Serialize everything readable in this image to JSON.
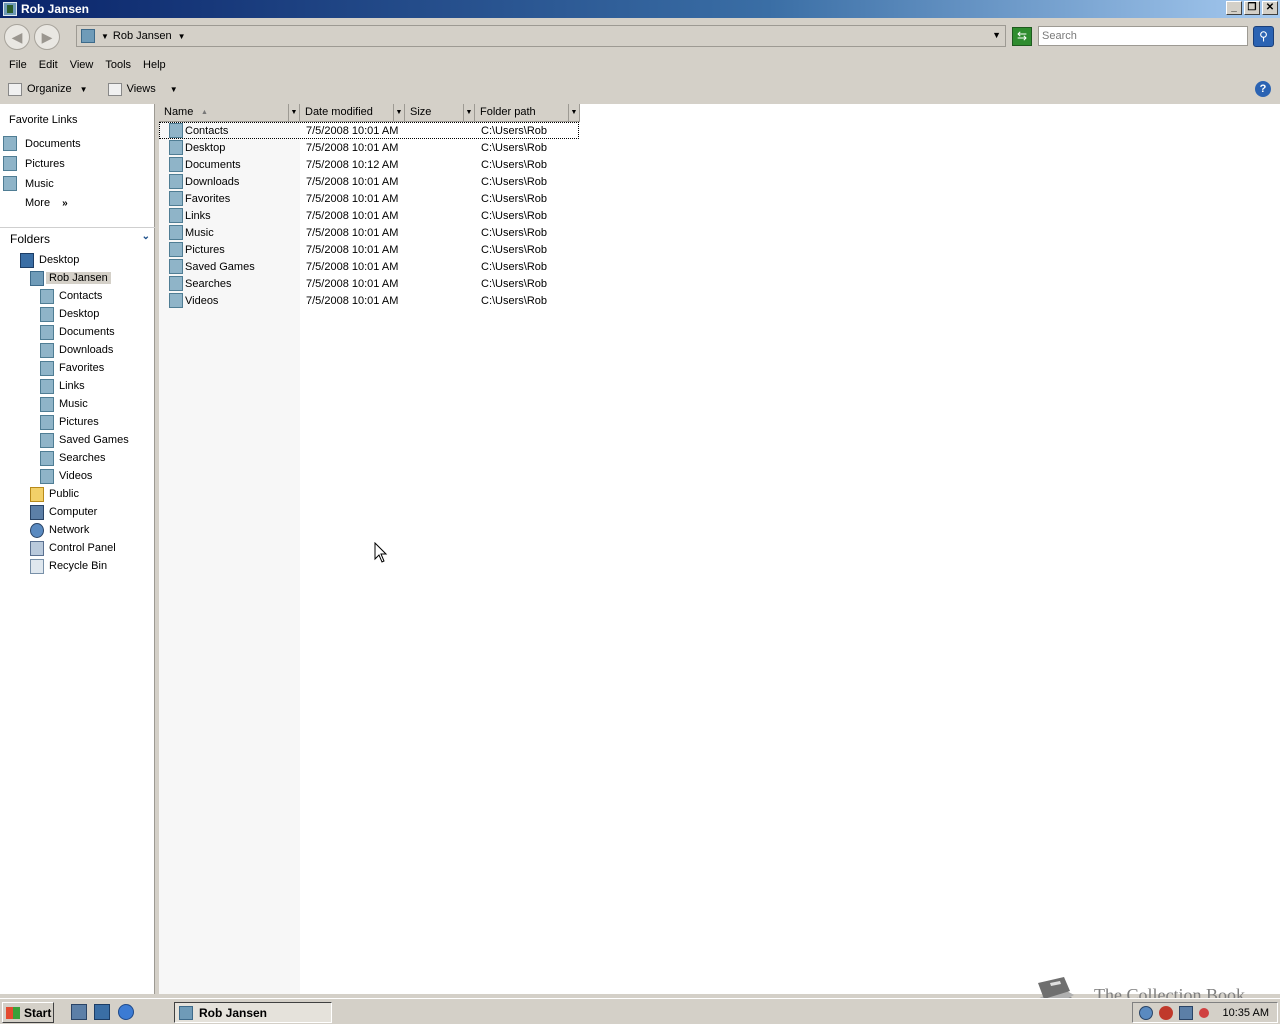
{
  "window": {
    "title": "Rob Jansen",
    "minimize_icon": "minimize-icon",
    "restore_icon": "restore-icon",
    "close_icon": "close-icon"
  },
  "address": {
    "location": "Rob Jansen",
    "search_placeholder": "Search"
  },
  "menu": {
    "items": [
      "File",
      "Edit",
      "View",
      "Tools",
      "Help"
    ]
  },
  "toolbar": {
    "organize_label": "Organize",
    "views_label": "Views"
  },
  "navpane": {
    "favorites_title": "Favorite Links",
    "favorites": [
      "Documents",
      "Pictures",
      "Music"
    ],
    "more_label": "More",
    "folders_title": "Folders",
    "tree": [
      {
        "label": "Desktop",
        "icon": "desktop-icon"
      },
      {
        "label": "Rob Jansen",
        "icon": "user-folder-icon"
      },
      {
        "label": "Contacts",
        "icon": "folder-icon"
      },
      {
        "label": "Desktop",
        "icon": "folder-icon"
      },
      {
        "label": "Documents",
        "icon": "folder-icon"
      },
      {
        "label": "Downloads",
        "icon": "folder-icon"
      },
      {
        "label": "Favorites",
        "icon": "folder-icon"
      },
      {
        "label": "Links",
        "icon": "folder-icon"
      },
      {
        "label": "Music",
        "icon": "folder-icon"
      },
      {
        "label": "Pictures",
        "icon": "folder-icon"
      },
      {
        "label": "Saved Games",
        "icon": "folder-icon"
      },
      {
        "label": "Searches",
        "icon": "folder-icon"
      },
      {
        "label": "Videos",
        "icon": "folder-icon"
      },
      {
        "label": "Public",
        "icon": "folder-icon"
      },
      {
        "label": "Computer",
        "icon": "computer-icon"
      },
      {
        "label": "Network",
        "icon": "network-icon"
      },
      {
        "label": "Control Panel",
        "icon": "control-panel-icon"
      },
      {
        "label": "Recycle Bin",
        "icon": "recycle-bin-icon"
      }
    ]
  },
  "columns": {
    "name": "Name",
    "date": "Date modified",
    "size": "Size",
    "path": "Folder path"
  },
  "files": [
    {
      "name": "Contacts",
      "date": "7/5/2008 10:01 AM",
      "path": "C:\\Users\\Rob"
    },
    {
      "name": "Desktop",
      "date": "7/5/2008 10:01 AM",
      "path": "C:\\Users\\Rob"
    },
    {
      "name": "Documents",
      "date": "7/5/2008 10:12 AM",
      "path": "C:\\Users\\Rob"
    },
    {
      "name": "Downloads",
      "date": "7/5/2008 10:01 AM",
      "path": "C:\\Users\\Rob"
    },
    {
      "name": "Favorites",
      "date": "7/5/2008 10:01 AM",
      "path": "C:\\Users\\Rob"
    },
    {
      "name": "Links",
      "date": "7/5/2008 10:01 AM",
      "path": "C:\\Users\\Rob"
    },
    {
      "name": "Music",
      "date": "7/5/2008 10:01 AM",
      "path": "C:\\Users\\Rob"
    },
    {
      "name": "Pictures",
      "date": "7/5/2008 10:01 AM",
      "path": "C:\\Users\\Rob"
    },
    {
      "name": "Saved Games",
      "date": "7/5/2008 10:01 AM",
      "path": "C:\\Users\\Rob"
    },
    {
      "name": "Searches",
      "date": "7/5/2008 10:01 AM",
      "path": "C:\\Users\\Rob"
    },
    {
      "name": "Videos",
      "date": "7/5/2008 10:01 AM",
      "path": "C:\\Users\\Rob"
    }
  ],
  "watermark": "The Collection Book",
  "taskbar": {
    "start_label": "Start",
    "task_label": "Rob Jansen",
    "clock": "10:35 AM"
  }
}
